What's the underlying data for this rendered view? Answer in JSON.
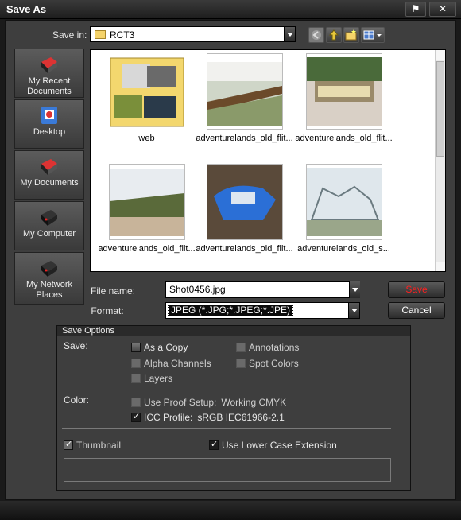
{
  "window": {
    "title": "Save As",
    "accent": "#ff2020"
  },
  "toolbar": {
    "save_in_label": "Save in:",
    "folder_value": "RCT3"
  },
  "places": [
    {
      "label": "My Recent Documents",
      "icon": "recent-documents-icon"
    },
    {
      "label": "Desktop",
      "icon": "desktop-icon"
    },
    {
      "label": "My Documents",
      "icon": "my-documents-icon"
    },
    {
      "label": "My Computer",
      "icon": "my-computer-icon"
    },
    {
      "label": "My Network Places",
      "icon": "network-places-icon"
    }
  ],
  "files": [
    {
      "name": "web",
      "kind": "folder"
    },
    {
      "name": "adventurelands_old_flit...",
      "kind": "image"
    },
    {
      "name": "adventurelands_old_flit...",
      "kind": "image"
    },
    {
      "name": "adventurelands_old_flit...",
      "kind": "image"
    },
    {
      "name": "adventurelands_old_flit...",
      "kind": "image"
    },
    {
      "name": "adventurelands_old_s...",
      "kind": "image"
    }
  ],
  "form": {
    "file_name_label": "File name:",
    "file_name_value": "Shot0456.jpg",
    "format_label": "Format:",
    "format_value": "JPEG (*.JPG;*.JPEG;*.JPE)",
    "save_button": "Save",
    "cancel_button": "Cancel"
  },
  "options": {
    "title": "Save Options",
    "save_label": "Save:",
    "as_copy": "As a Copy",
    "annotations": "Annotations",
    "alpha_channels": "Alpha Channels",
    "spot_colors": "Spot Colors",
    "layers": "Layers",
    "color_label": "Color:",
    "use_proof_setup": "Use Proof Setup:",
    "proof_value": "Working CMYK",
    "icc_profile": "ICC Profile:",
    "icc_value": "sRGB IEC61966-2.1",
    "thumbnail": "Thumbnail",
    "lower_case": "Use Lower Case Extension"
  }
}
